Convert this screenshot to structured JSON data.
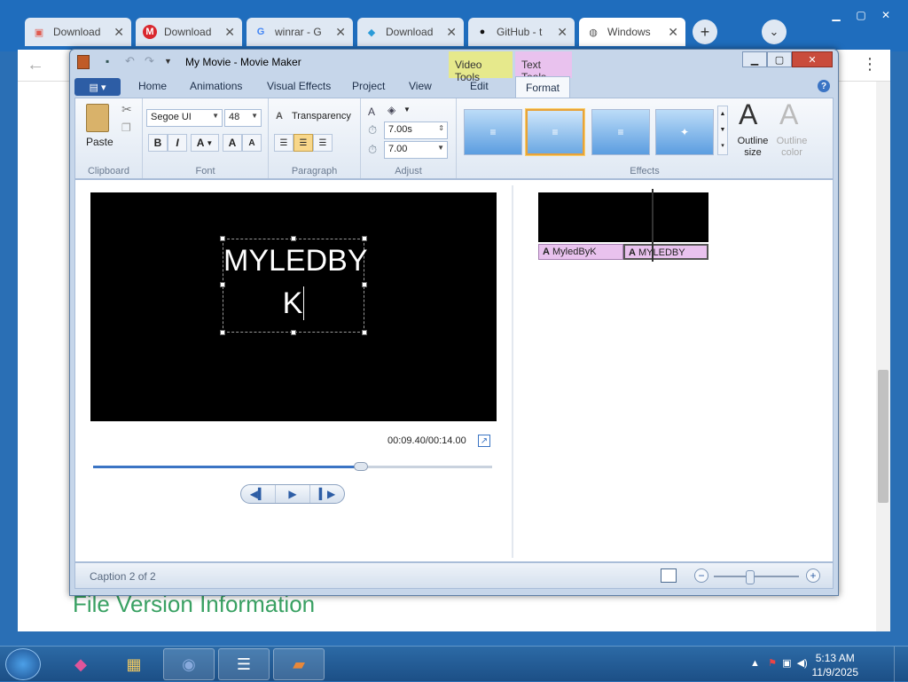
{
  "browser": {
    "tabs": [
      {
        "title": "Download",
        "favicon": "download-icon"
      },
      {
        "title": "Download",
        "favicon": "mega-icon"
      },
      {
        "title": "winrar - G",
        "favicon": "google-icon"
      },
      {
        "title": "Download",
        "favicon": "download-arrow-icon"
      },
      {
        "title": "GitHub - t",
        "favicon": "github-icon"
      },
      {
        "title": "Windows",
        "favicon": "globe-icon"
      }
    ],
    "page_heading": "File Version Information"
  },
  "app": {
    "title": "My Movie - Movie Maker",
    "contextual": {
      "video_tools": "Video Tools",
      "text_tools": "Text Tools"
    },
    "tabs": [
      "Home",
      "Animations",
      "Visual Effects",
      "Project",
      "View",
      "Edit",
      "Format"
    ]
  },
  "ribbon": {
    "clipboard": {
      "paste": "Paste",
      "label": "Clipboard"
    },
    "font": {
      "family": "Segoe UI",
      "size": "48",
      "label": "Font",
      "bold": "B",
      "italic": "I",
      "color": "A",
      "grow": "A",
      "shrink": "A"
    },
    "paragraph": {
      "transparency": "Transparency",
      "label": "Paragraph"
    },
    "adjust": {
      "start_time": "7.00s",
      "duration": "7.00",
      "label": "Adjust"
    },
    "effects": {
      "label": "Effects",
      "outline_size": "Outline size",
      "outline_color": "Outline color"
    }
  },
  "preview": {
    "caption_line1": "MYLEDBY",
    "caption_line2": "K",
    "time": "00:09.40/00:14.00",
    "seek_fraction": 0.67
  },
  "storyboard": {
    "captions": [
      "MyledByK",
      "MYLEDBY"
    ]
  },
  "status": {
    "text": "Caption 2 of 2",
    "zoom_fraction": 0.43
  },
  "taskbar": {
    "time": "5:13 AM",
    "date": "11/9/2025"
  }
}
